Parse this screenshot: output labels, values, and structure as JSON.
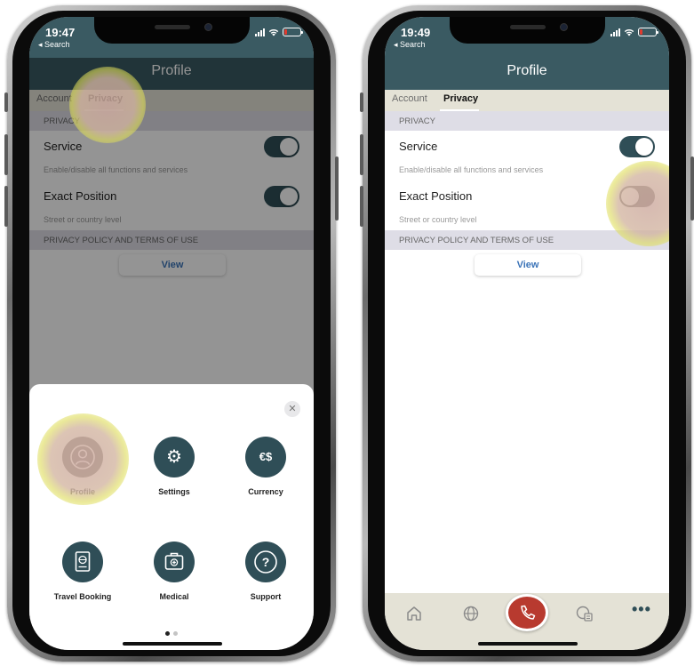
{
  "phones": [
    {
      "status": {
        "time": "19:47",
        "back": "◂ Search"
      },
      "nav": {
        "title": "Profile"
      },
      "tabs": [
        "Account",
        "Privacy"
      ],
      "privacy": {
        "header": "PRIVACY",
        "service": {
          "label": "Service",
          "on": true,
          "helper": "Enable/disable all functions and services"
        },
        "exact_position": {
          "label": "Exact Position",
          "on": true,
          "helper": "Street or country level"
        },
        "policy_header": "PRIVACY POLICY AND TERMS OF USE",
        "view_label": "View"
      },
      "sheet": {
        "close_icon": "close-icon",
        "items": [
          {
            "label": "Profile",
            "icon": "person-icon"
          },
          {
            "label": "Settings",
            "icon": "gear-icon"
          },
          {
            "label": "Currency",
            "icon": "currency-exchange-icon"
          },
          {
            "label": "Travel Booking",
            "icon": "passport-icon"
          },
          {
            "label": "Medical",
            "icon": "medical-kit-icon"
          },
          {
            "label": "Support",
            "icon": "question-icon"
          }
        ],
        "page_count": 2,
        "current_page": 1
      }
    },
    {
      "status": {
        "time": "19:49",
        "back": "◂ Search"
      },
      "nav": {
        "title": "Profile"
      },
      "tabs": [
        "Account",
        "Privacy"
      ],
      "privacy": {
        "header": "PRIVACY",
        "service": {
          "label": "Service",
          "on": true,
          "helper": "Enable/disable all functions and services"
        },
        "exact_position": {
          "label": "Exact Position",
          "on": false,
          "helper": "Street or country level"
        },
        "policy_header": "PRIVACY POLICY AND TERMS OF USE",
        "view_label": "View"
      },
      "bottom_bar": {
        "items": [
          "home-icon",
          "globe-icon",
          "phone-call-icon",
          "map-document-icon",
          "more-icon"
        ],
        "more_label": "•••"
      }
    }
  ],
  "colors": {
    "header_teal": "#3a5a62",
    "tab_beige": "#e4e2d6",
    "toggle_on": "#2f4e57",
    "toggle_off": "#6c6c6c",
    "call_red": "#b83a2f",
    "link_blue": "#3c74b8",
    "highlight": "#dede60"
  }
}
